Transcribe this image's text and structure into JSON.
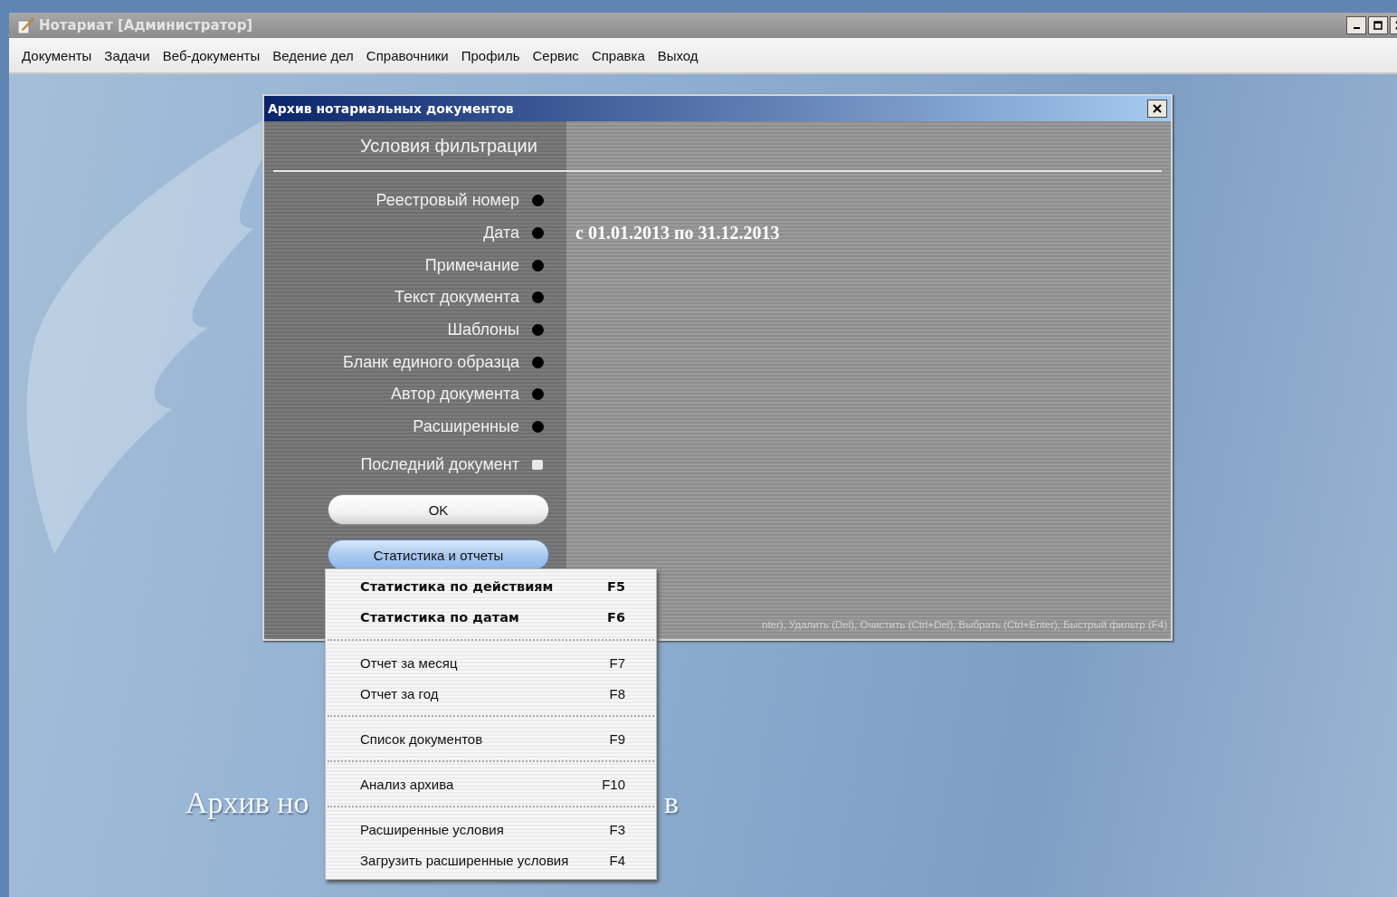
{
  "window": {
    "title": "Нотариат [Администратор]"
  },
  "menu_bar": [
    "Документы",
    "Задачи",
    "Веб-документы",
    "Ведение дел",
    "Справочники",
    "Профиль",
    "Сервис",
    "Справка",
    "Выход"
  ],
  "background_title": {
    "left_part": "Архив но",
    "right_part": "в"
  },
  "dialog": {
    "title": "Архив нотариальных документов",
    "header": "Условия фильтрации",
    "filters": [
      {
        "label": "Реестровый номер"
      },
      {
        "label": "Дата",
        "value": "с 01.01.2013 по 31.12.2013"
      },
      {
        "label": "Примечание"
      },
      {
        "label": "Текст документа"
      },
      {
        "label": "Шаблоны"
      },
      {
        "label": "Бланк единого образца"
      },
      {
        "label": "Автор документа"
      },
      {
        "label": "Расширенные"
      }
    ],
    "last_document": {
      "label": "Последний документ",
      "checked": false
    },
    "ok_button": "OK",
    "stats_button": "Статистика и отчеты",
    "hint": "nter), Удалить (Del), Очистить (Ctrl+Del), Выбрать (Ctrl+Enter), Быстрый фильтр (F4)"
  },
  "popup_menu": [
    [
      {
        "label": "Статистика по действиям",
        "shortcut": "F5",
        "bold": true
      },
      {
        "label": "Статистика по датам",
        "shortcut": "F6",
        "bold": true
      }
    ],
    [
      {
        "label": "Отчет за месяц",
        "shortcut": "F7",
        "bold": false
      },
      {
        "label": "Отчет за год",
        "shortcut": "F8",
        "bold": false
      }
    ],
    [
      {
        "label": "Список документов",
        "shortcut": "F9",
        "bold": false
      }
    ],
    [
      {
        "label": "Анализ архива",
        "shortcut": "F10",
        "bold": false
      }
    ],
    [
      {
        "label": "Расширенные условия",
        "shortcut": "F3",
        "bold": false
      },
      {
        "label": "Загрузить расширенные условия",
        "shortcut": "F4",
        "bold": false
      }
    ]
  ]
}
